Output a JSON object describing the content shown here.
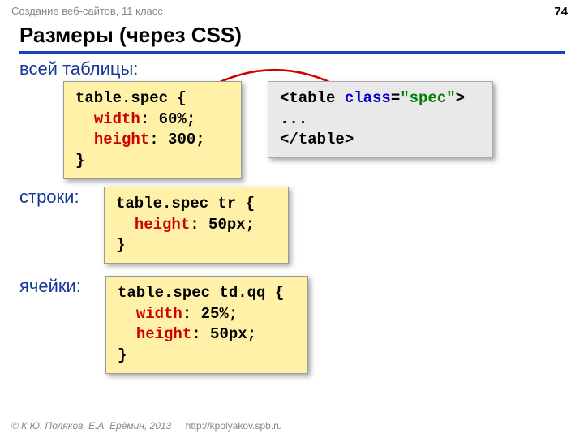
{
  "header": {
    "course": "Создание веб-сайтов, 11 класс",
    "page": "74"
  },
  "title": "Размеры (через CSS)",
  "labels": {
    "table": "всей таблицы:",
    "row": "строки:",
    "cell": "ячейки:"
  },
  "code1": {
    "l1a": "table.spec {",
    "l2_p": "width",
    "l2_v": ": 60%;",
    "l3_p": "height",
    "l3_v": ": 300;",
    "l4": "}"
  },
  "code2": {
    "l1a": "table.spec tr {",
    "l2_p": "height",
    "l2_v": ": 50px;",
    "l3": "}"
  },
  "code3": {
    "l1a": "table.spec td.qq {",
    "l2_p": "width",
    "l2_v": ": 25%;",
    "l3_p": "height",
    "l3_v": ": 50px;",
    "l4": "}"
  },
  "html1": {
    "lt": "<",
    "tag": "table",
    "sp": " ",
    "attr": "class",
    "eq": "=",
    "val": "\"spec\"",
    "gt": ">",
    "mid": "...",
    "clt": "</",
    "ctag": "table",
    "cgt": ">"
  },
  "footer": {
    "credit": "© К.Ю. Поляков, Е.А. Ерёмин, 2013",
    "url": "http://kpolyakov.spb.ru"
  }
}
